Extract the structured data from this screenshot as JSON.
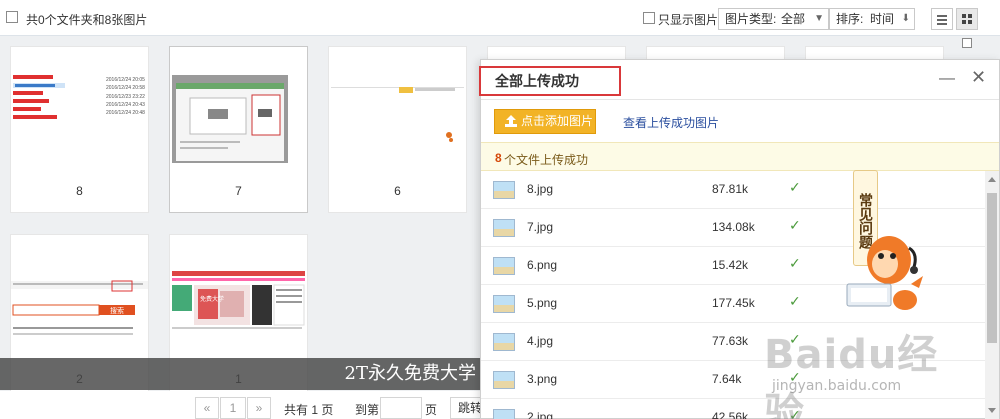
{
  "toolbar": {
    "summary": "共0个文件夹和8张图片",
    "only_images_label": "只显示图片",
    "image_type_label": "图片类型:",
    "image_type_value": "全部",
    "sort_label": "排序:",
    "sort_value": "时间"
  },
  "cards": [
    {
      "label": "8"
    },
    {
      "label": "7"
    },
    {
      "label": "6"
    },
    {
      "label": "2"
    },
    {
      "label": "1"
    }
  ],
  "thumb_text": {
    "card8_dates": [
      "2016/12/24 20:05",
      "2016/12/24 20:58",
      "2016/12/23 23:22",
      "2016/12/24 20:43",
      "2016/12/24 20:48"
    ],
    "card2_search_btn": "搜索",
    "card1_text": "免费大学"
  },
  "banner": {
    "text": "2T永久免费大学"
  },
  "pager": {
    "prev": "«",
    "page": "1",
    "next": "»",
    "total": "共有 1 页",
    "goto_label": "到第",
    "page_unit": "页",
    "jump": "跳转"
  },
  "dialog": {
    "title": "全部上传成功",
    "add_button": "点击添加图片",
    "view_link": "查看上传成功图片",
    "success_count": "8",
    "success_text": "个文件上传成功",
    "files": [
      {
        "name": "8.jpg",
        "size": "87.81k"
      },
      {
        "name": "7.jpg",
        "size": "134.08k"
      },
      {
        "name": "6.png",
        "size": "15.42k"
      },
      {
        "name": "5.png",
        "size": "177.45k"
      },
      {
        "name": "4.jpg",
        "size": "77.63k"
      },
      {
        "name": "3.png",
        "size": "7.64k"
      },
      {
        "name": "2.jpg",
        "size": "42.56k"
      }
    ],
    "check": "✓"
  },
  "help": {
    "label": "常见问题"
  },
  "watermark": {
    "logo": "Baidu经验",
    "url": "jingyan.baidu.com"
  },
  "colors": {
    "add_button": "#f2b326",
    "title_highlight": "#d9383a",
    "success_count": "#d4480a",
    "link": "#2a4e9e"
  }
}
